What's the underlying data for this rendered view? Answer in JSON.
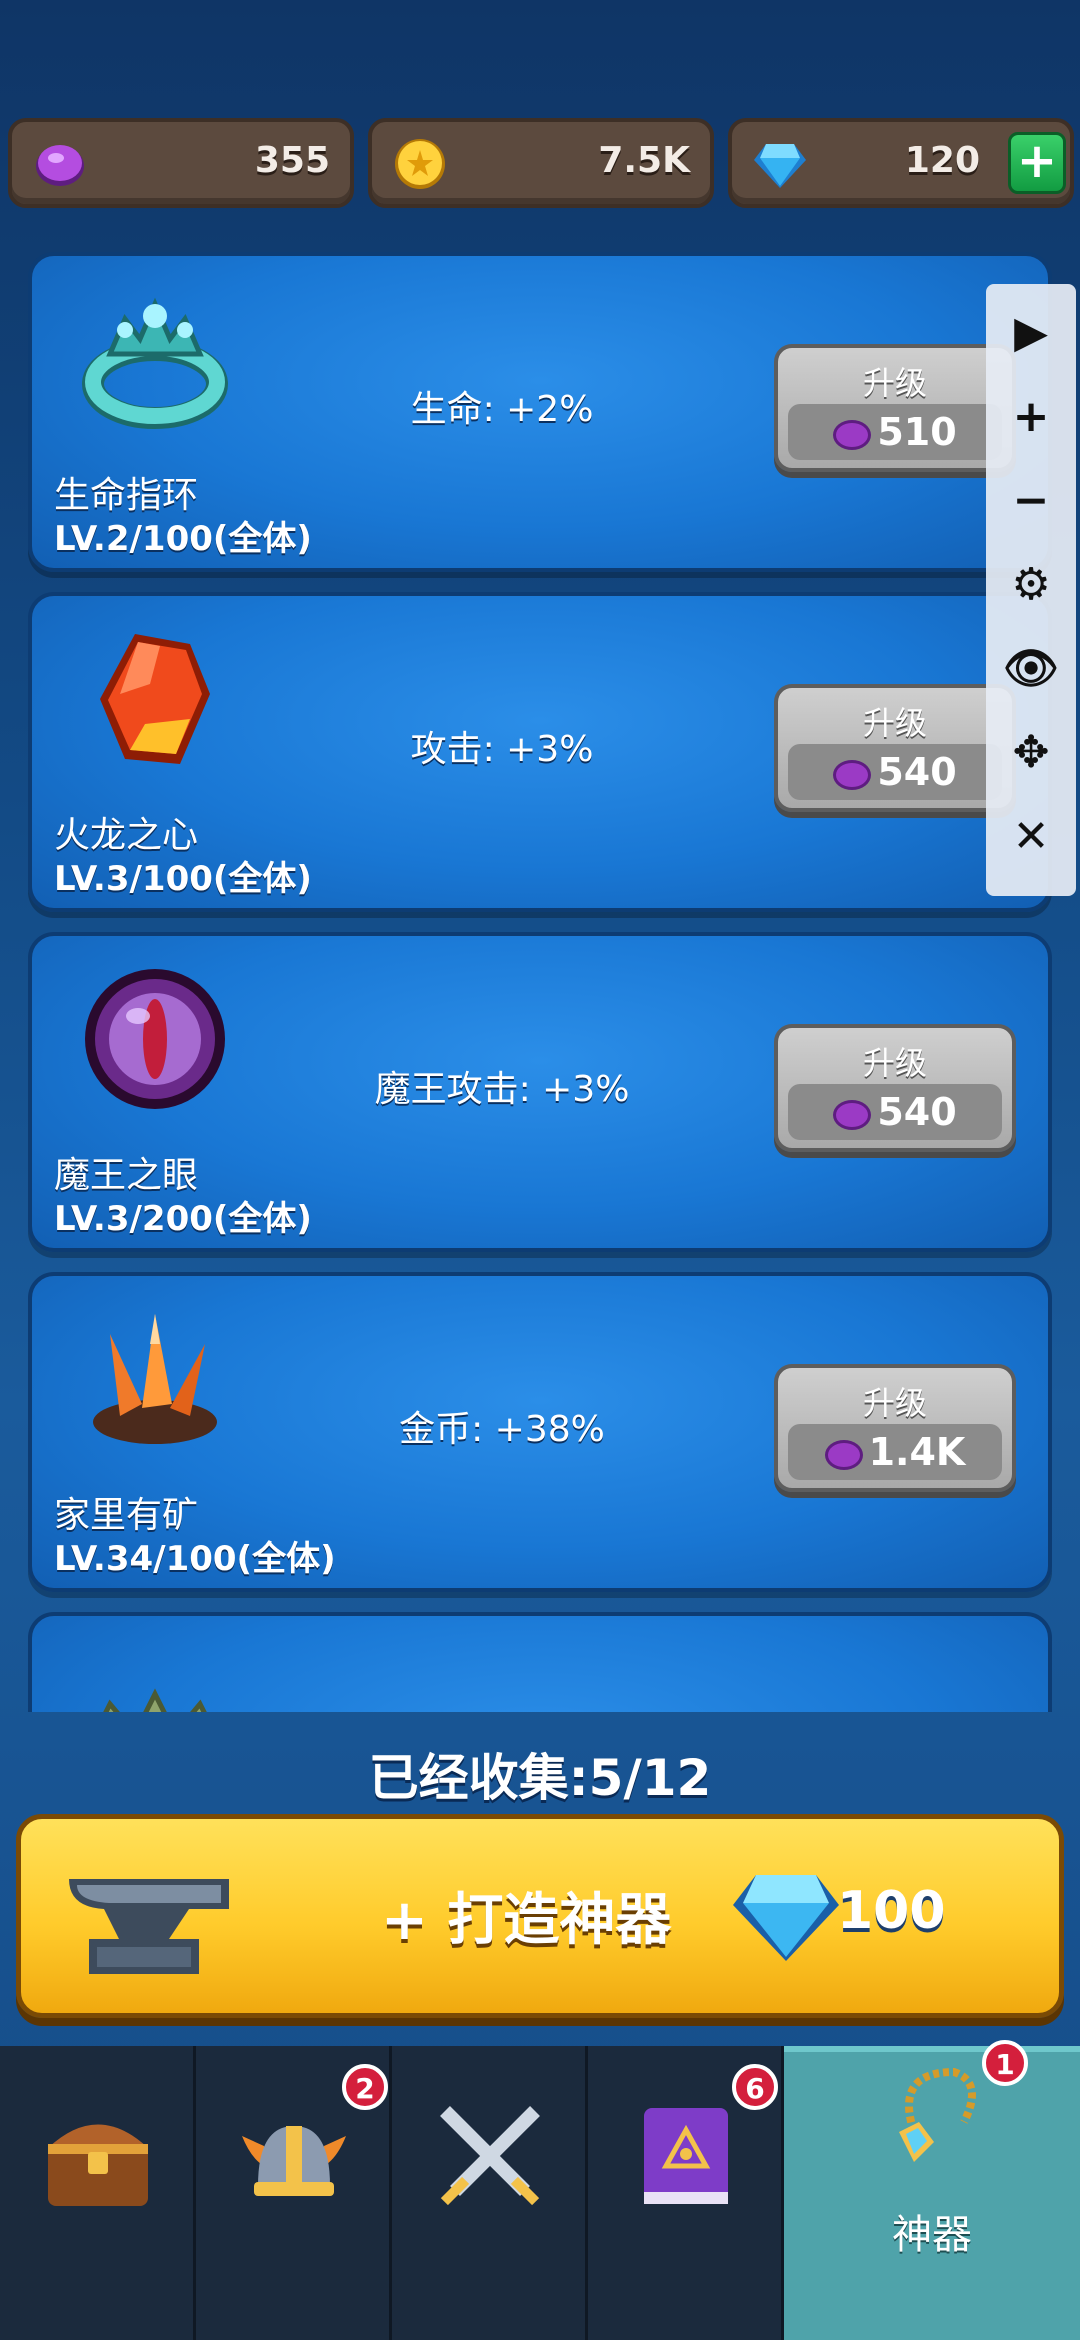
{
  "currencies": [
    {
      "name": "purple-gem",
      "amount": "355"
    },
    {
      "name": "gold-coin",
      "amount": "7.5K"
    },
    {
      "name": "diamond",
      "amount": "120",
      "add_label": "+"
    }
  ],
  "artifacts": [
    {
      "name": "生命指环",
      "level": "LV.2/100(全体)",
      "effect": "生命: +2%",
      "upgrade_label": "升级",
      "cost": "510",
      "icon": "ring-icon"
    },
    {
      "name": "火龙之心",
      "level": "LV.3/100(全体)",
      "effect": "攻击: +3%",
      "upgrade_label": "升级",
      "cost": "540",
      "icon": "fire-crystal-icon"
    },
    {
      "name": "魔王之眼",
      "level": "LV.3/200(全体)",
      "effect": "魔王攻击: +3%",
      "upgrade_label": "升级",
      "cost": "540",
      "icon": "demon-eye-icon"
    },
    {
      "name": "家里有矿",
      "level": "LV.34/100(全体)",
      "effect": "金币: +38%",
      "upgrade_label": "升级",
      "cost": "1.4K",
      "icon": "ore-crystal-icon"
    }
  ],
  "toolbar": {
    "items": [
      {
        "name": "play-icon",
        "glyph": "▶"
      },
      {
        "name": "zoom-in-icon",
        "glyph": "+"
      },
      {
        "name": "zoom-out-icon",
        "glyph": "−"
      },
      {
        "name": "gear-icon",
        "glyph": "⚙"
      },
      {
        "name": "eye-icon",
        "glyph": "👁"
      },
      {
        "name": "move-icon",
        "glyph": "✥"
      },
      {
        "name": "close-icon",
        "glyph": "✕"
      }
    ]
  },
  "collection": {
    "label": "已经收集:5/12"
  },
  "forge": {
    "label": "+ 打造神器",
    "cost": "100"
  },
  "nav": {
    "tabs": [
      {
        "name": "treasure-chest-tab",
        "label": "",
        "badge": ""
      },
      {
        "name": "viking-helmet-tab",
        "label": "",
        "badge": "2"
      },
      {
        "name": "crossed-swords-tab",
        "label": "",
        "badge": ""
      },
      {
        "name": "spellbook-tab",
        "label": "",
        "badge": "6"
      },
      {
        "name": "artifact-tab",
        "label": "神器",
        "badge": "1"
      }
    ]
  },
  "colors": {
    "accent": "#ffcb2b",
    "card": "#1977d4",
    "active_tab": "#4fa3aa",
    "badge": "#d41f3c"
  }
}
